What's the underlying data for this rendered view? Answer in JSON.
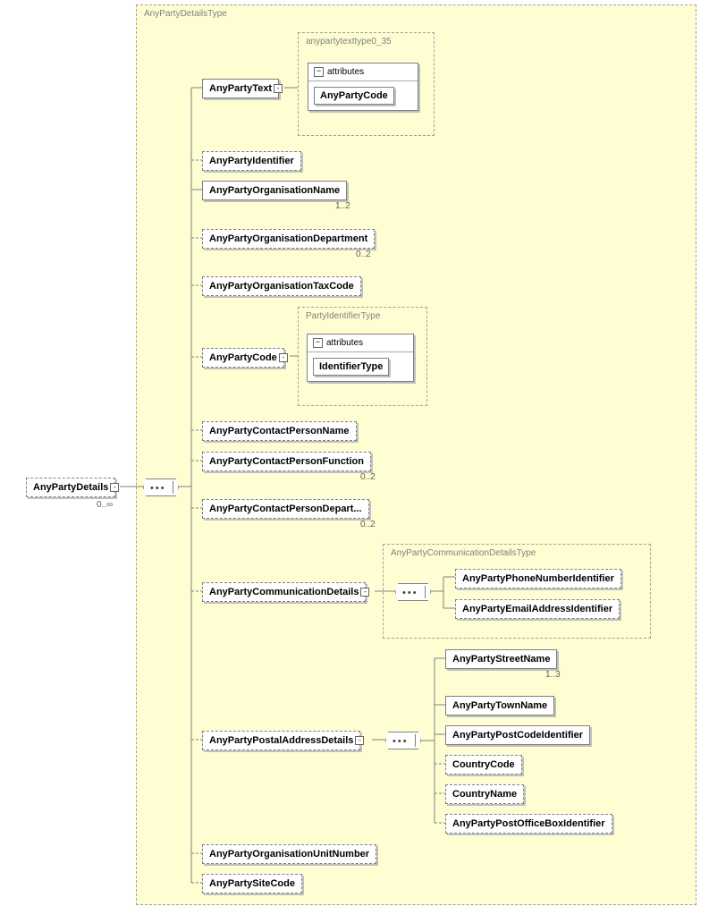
{
  "root": {
    "label": "AnyPartyDetails",
    "card": "0..∞"
  },
  "outerGroup": {
    "title": "AnyPartyDetailsType"
  },
  "children": {
    "anyPartyText": {
      "label": "AnyPartyText"
    },
    "anyPartyTextGroup": {
      "title": "anypartytexttype0_35"
    },
    "anyPartyText_attr_hdr": "attributes",
    "anyPartyText_attr": {
      "label": "AnyPartyCode"
    },
    "anyPartyIdentifier": {
      "label": "AnyPartyIdentifier"
    },
    "anyPartyOrgName": {
      "label": "AnyPartyOrganisationName",
      "card": "1..2"
    },
    "anyPartyOrgDept": {
      "label": "AnyPartyOrganisationDepartment",
      "card": "0..2"
    },
    "anyPartyOrgTax": {
      "label": "AnyPartyOrganisationTaxCode"
    },
    "anyPartyCode": {
      "label": "AnyPartyCode"
    },
    "partyIdGroup": {
      "title": "PartyIdentifierType"
    },
    "partyId_attr_hdr": "attributes",
    "partyId_attr": {
      "label": "IdentifierType"
    },
    "contactName": {
      "label": "AnyPartyContactPersonName"
    },
    "contactFunction": {
      "label": "AnyPartyContactPersonFunction",
      "card": "0..2"
    },
    "contactDept": {
      "label": "AnyPartyContactPersonDepart...",
      "card": "0..2"
    },
    "commDetails": {
      "label": "AnyPartyCommunicationDetails"
    },
    "commGroup": {
      "title": "AnyPartyCommunicationDetailsType"
    },
    "phone": {
      "label": "AnyPartyPhoneNumberIdentifier"
    },
    "email": {
      "label": "AnyPartyEmailAddressIdentifier"
    },
    "postalDetails": {
      "label": "AnyPartyPostalAddressDetails"
    },
    "street": {
      "label": "AnyPartyStreetName",
      "card": "1..3"
    },
    "town": {
      "label": "AnyPartyTownName"
    },
    "postcode": {
      "label": "AnyPartyPostCodeIdentifier"
    },
    "countryCode": {
      "label": "CountryCode"
    },
    "countryName": {
      "label": "CountryName"
    },
    "poBox": {
      "label": "AnyPartyPostOfficeBoxIdentifier"
    },
    "orgUnit": {
      "label": "AnyPartyOrganisationUnitNumber"
    },
    "siteCode": {
      "label": "AnyPartySiteCode"
    }
  }
}
